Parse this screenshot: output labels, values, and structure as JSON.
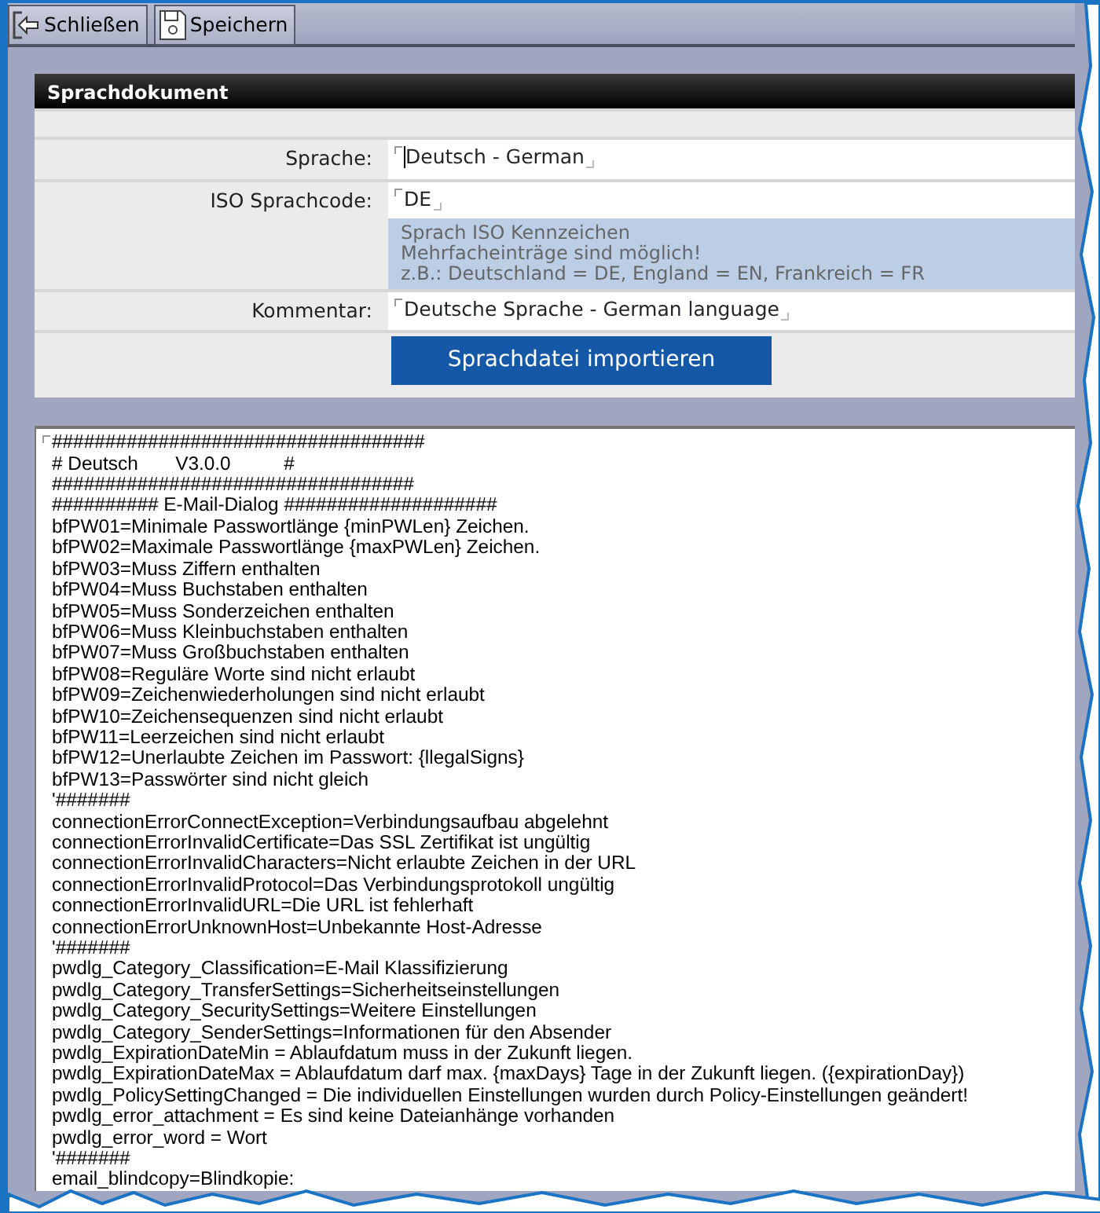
{
  "toolbar": {
    "buttons": [
      {
        "label": "Schließen",
        "kind": "exit"
      },
      {
        "label": "Speichern",
        "kind": "save"
      }
    ]
  },
  "panel": {
    "title": "Sprachdokument",
    "fields": [
      {
        "label": "Sprache:",
        "value": "Deutsch - German",
        "focused": true
      },
      {
        "label": "ISO Sprachcode:",
        "value": "DE",
        "focused": false,
        "hint": [
          "Sprach ISO Kennzeichen",
          "Mehrfacheinträge sind möglich!",
          "z.B.: Deutschland = DE, England = EN, Frankreich = FR"
        ]
      },
      {
        "label": "Kommentar:",
        "value": "Deutsche Sprache - German language",
        "focused": false
      }
    ],
    "import_button": "Sprachdatei importieren"
  },
  "editor": {
    "lines": [
      "###################################",
      "# Deutsch       V3.0.0          #",
      "##################################",
      "########## E-Mail-Dialog ####################",
      "bfPW01=Minimale Passwortlänge {minPWLen} Zeichen.",
      "bfPW02=Maximale Passwortlänge {maxPWLen} Zeichen.",
      "bfPW03=Muss Ziffern enthalten",
      "bfPW04=Muss Buchstaben enthalten",
      "bfPW05=Muss Sonderzeichen enthalten",
      "bfPW06=Muss Kleinbuchstaben enthalten",
      "bfPW07=Muss Großbuchstaben enthalten",
      "bfPW08=Reguläre Worte sind nicht erlaubt",
      "bfPW09=Zeichenwiederholungen sind nicht erlaubt",
      "bfPW10=Zeichensequenzen sind nicht erlaubt",
      "bfPW11=Leerzeichen sind nicht erlaubt",
      "bfPW12=Unerlaubte Zeichen im Passwort: {llegalSigns}",
      "bfPW13=Passwörter sind nicht gleich",
      "'#######",
      "connectionErrorConnectException=Verbindungsaufbau abgelehnt",
      "connectionErrorInvalidCertificate=Das SSL Zertifikat ist ungültig",
      "connectionErrorInvalidCharacters=Nicht erlaubte Zeichen in der URL",
      "connectionErrorInvalidProtocol=Das Verbindungsprotokoll ungültig",
      "connectionErrorInvalidURL=Die URL ist fehlerhaft",
      "connectionErrorUnknownHost=Unbekannte Host-Adresse",
      "'#######",
      "pwdlg_Category_Classification=E-Mail Klassifizierung",
      "pwdlg_Category_TransferSettings=Sicherheitseinstellungen",
      "pwdlg_Category_SecuritySettings=Weitere Einstellungen",
      "pwdlg_Category_SenderSettings=Informationen für den Absender",
      "pwdlg_ExpirationDateMin = Ablaufdatum muss in der Zukunft liegen.",
      "pwdlg_ExpirationDateMax = Ablaufdatum darf max. {maxDays} Tage in der Zukunft liegen. ({expirationDay})",
      "pwdlg_PolicySettingChanged = Die individuellen Einstellungen wurden durch Policy-Einstellungen geändert!",
      "pwdlg_error_attachment = Es sind keine Dateianhänge vorhanden",
      "pwdlg_error_word = Wort",
      "'#######",
      "email_blindcopy=Blindkopie:"
    ]
  }
}
